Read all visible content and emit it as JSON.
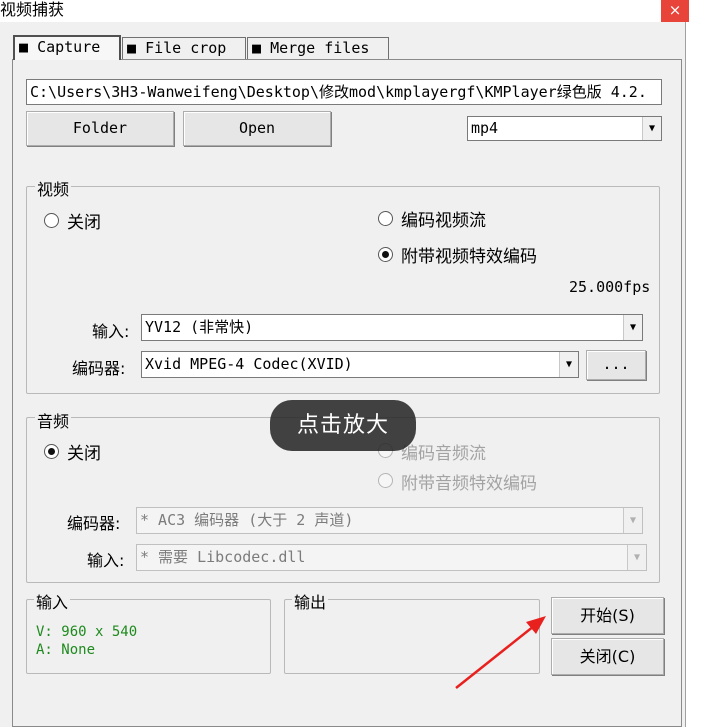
{
  "window": {
    "title": "视频捕获",
    "close_glyph": "×"
  },
  "tabs": [
    {
      "label": "Capture",
      "active": true
    },
    {
      "label": "File crop",
      "active": false
    },
    {
      "label": "Merge files",
      "active": false
    }
  ],
  "path_field": {
    "value": "C:\\Users\\3H3-Wanweifeng\\Desktop\\修改mod\\kmplayergf\\KMPlayer绿色版 4.2."
  },
  "buttons": {
    "folder": "Folder",
    "open": "Open",
    "browse": "...",
    "start": "开始(S)",
    "close": "关闭(C)"
  },
  "format_select": {
    "value": "mp4"
  },
  "video": {
    "label": "视频",
    "off": "关闭",
    "encode_stream": "编码视频流",
    "with_effects": "附带视频特效编码",
    "selected": "with_effects",
    "fps": "25.000fps",
    "input_label": "输入:",
    "input_value": "YV12 (非常快)",
    "codec_label": "编码器:",
    "codec_value": "Xvid MPEG-4 Codec(XVID)"
  },
  "audio": {
    "label": "音频",
    "off": "关闭",
    "encode_stream": "编码音频流",
    "with_effects": "附带音频特效编码",
    "selected": "off",
    "codec_label": "编码器:",
    "codec_value": "* AC3 编码器 (大于 2 声道)",
    "input_label": "输入:",
    "input_value": "* 需要 Libcodec.dll"
  },
  "input_info": {
    "label": "输入",
    "video_line": "V: 960 x 540",
    "audio_line": "A: None"
  },
  "output_info": {
    "label": "输出"
  },
  "overlay_hint": "点击放大",
  "colors": {
    "annotation_arrow": "#e8211f",
    "info_text": "#1e8a1e",
    "close_button": "#e8443a"
  },
  "icons": {
    "tab_marker": "square-icon",
    "dropdown": "chevron-down-icon"
  }
}
